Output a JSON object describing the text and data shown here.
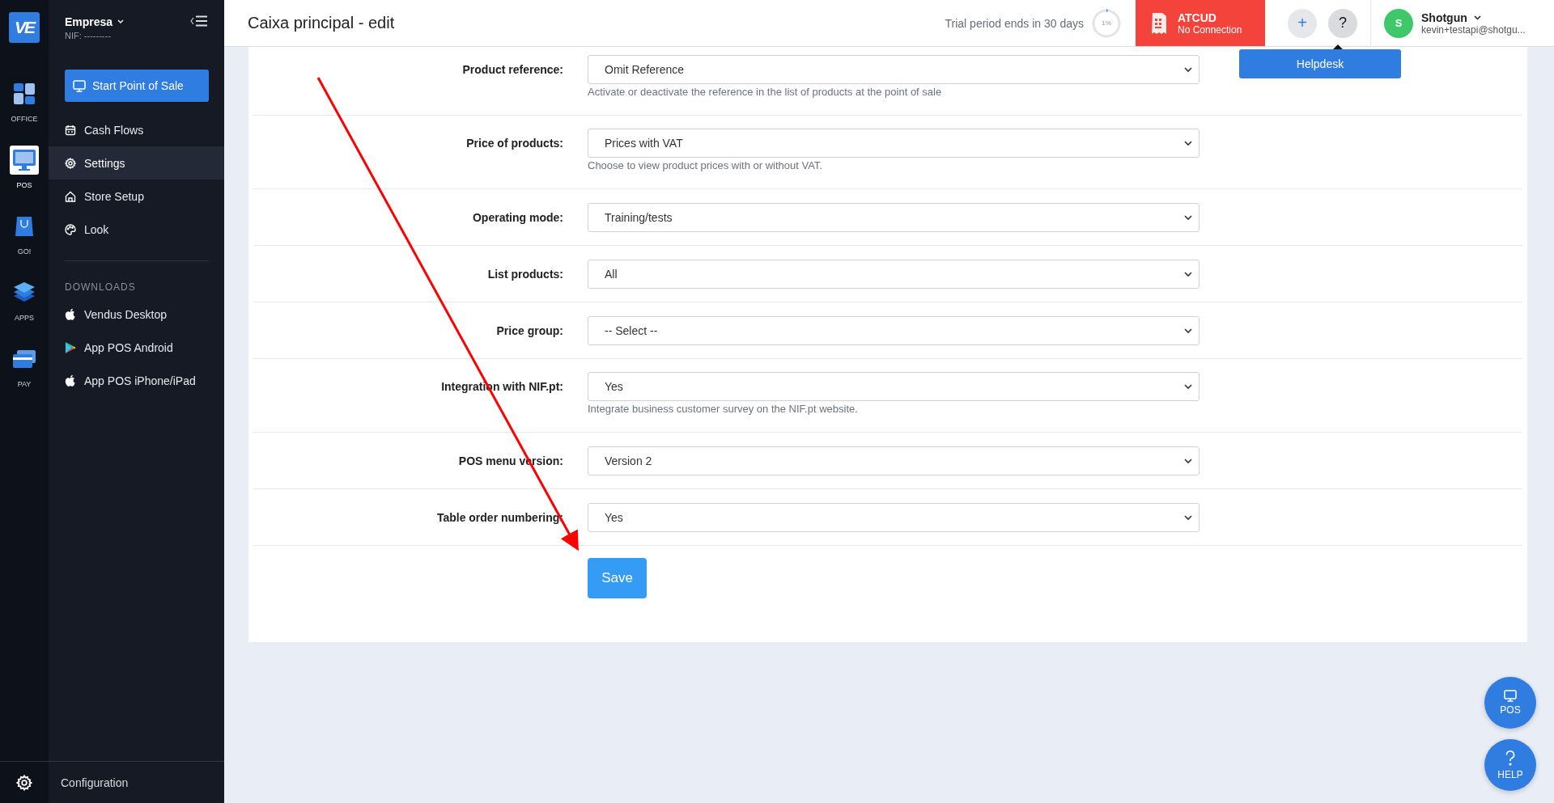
{
  "rail": {
    "logo": "VE",
    "items": [
      {
        "label": "OFFICE",
        "kind": "tiles",
        "selected": false
      },
      {
        "label": "POS",
        "kind": "monitor",
        "selected": true
      },
      {
        "label": "GO!",
        "kind": "bag",
        "selected": false
      },
      {
        "label": "APPS",
        "kind": "layers",
        "selected": false
      },
      {
        "label": "PAY",
        "kind": "card",
        "selected": false
      }
    ]
  },
  "sidebar": {
    "company": "Empresa",
    "nif": "NIF: ---------",
    "start_button": "Start Point of Sale",
    "items": [
      {
        "label": "Cash Flows",
        "kind": "calendar",
        "selected": false
      },
      {
        "label": "Settings",
        "kind": "gear",
        "selected": true
      },
      {
        "label": "Store Setup",
        "kind": "home",
        "selected": false
      },
      {
        "label": "Look",
        "kind": "palette",
        "selected": false
      }
    ],
    "downloads_heading": "DOWNLOADS",
    "downloads": [
      {
        "label": "Vendus Desktop",
        "kind": "apple"
      },
      {
        "label": "App POS Android",
        "kind": "play"
      },
      {
        "label": "App POS iPhone/iPad",
        "kind": "apple"
      }
    ],
    "footer": "Configuration"
  },
  "header": {
    "title": "Caixa principal - edit",
    "trial": "Trial period ends in 30 days",
    "trial_progress": {
      "label": "1%",
      "level": 0.01
    },
    "atcud": {
      "title": "ATCUD",
      "status": "No Connection"
    },
    "add_button": "+",
    "help_button": "?",
    "helpdesk": "Helpdesk",
    "user": {
      "initial": "S",
      "name": "Shotgun",
      "email": "kevin+testapi@shotgu..."
    }
  },
  "form": {
    "rows": [
      {
        "label": "Product reference:",
        "value": "Omit Reference",
        "help": "Activate or deactivate the reference in the list of products at the point of sale"
      },
      {
        "label": "Price of products:",
        "value": "Prices with VAT",
        "help": "Choose to view product prices with or without VAT."
      },
      {
        "label": "Operating mode:",
        "value": "Training/tests"
      },
      {
        "label": "List products:",
        "value": "All"
      },
      {
        "label": "Price group:",
        "value": "-- Select --"
      },
      {
        "label": "Integration with NIF.pt:",
        "value": "Yes",
        "help": "Integrate business customer survey on the NIF.pt website."
      },
      {
        "label": "POS menu version:",
        "value": "Version 2"
      },
      {
        "label": "Table order numbering:",
        "value": "Yes"
      }
    ],
    "save_button": "Save"
  },
  "floating": [
    {
      "label": "POS",
      "kind": "monitor"
    },
    {
      "label": "HELP",
      "kind": "question"
    }
  ]
}
